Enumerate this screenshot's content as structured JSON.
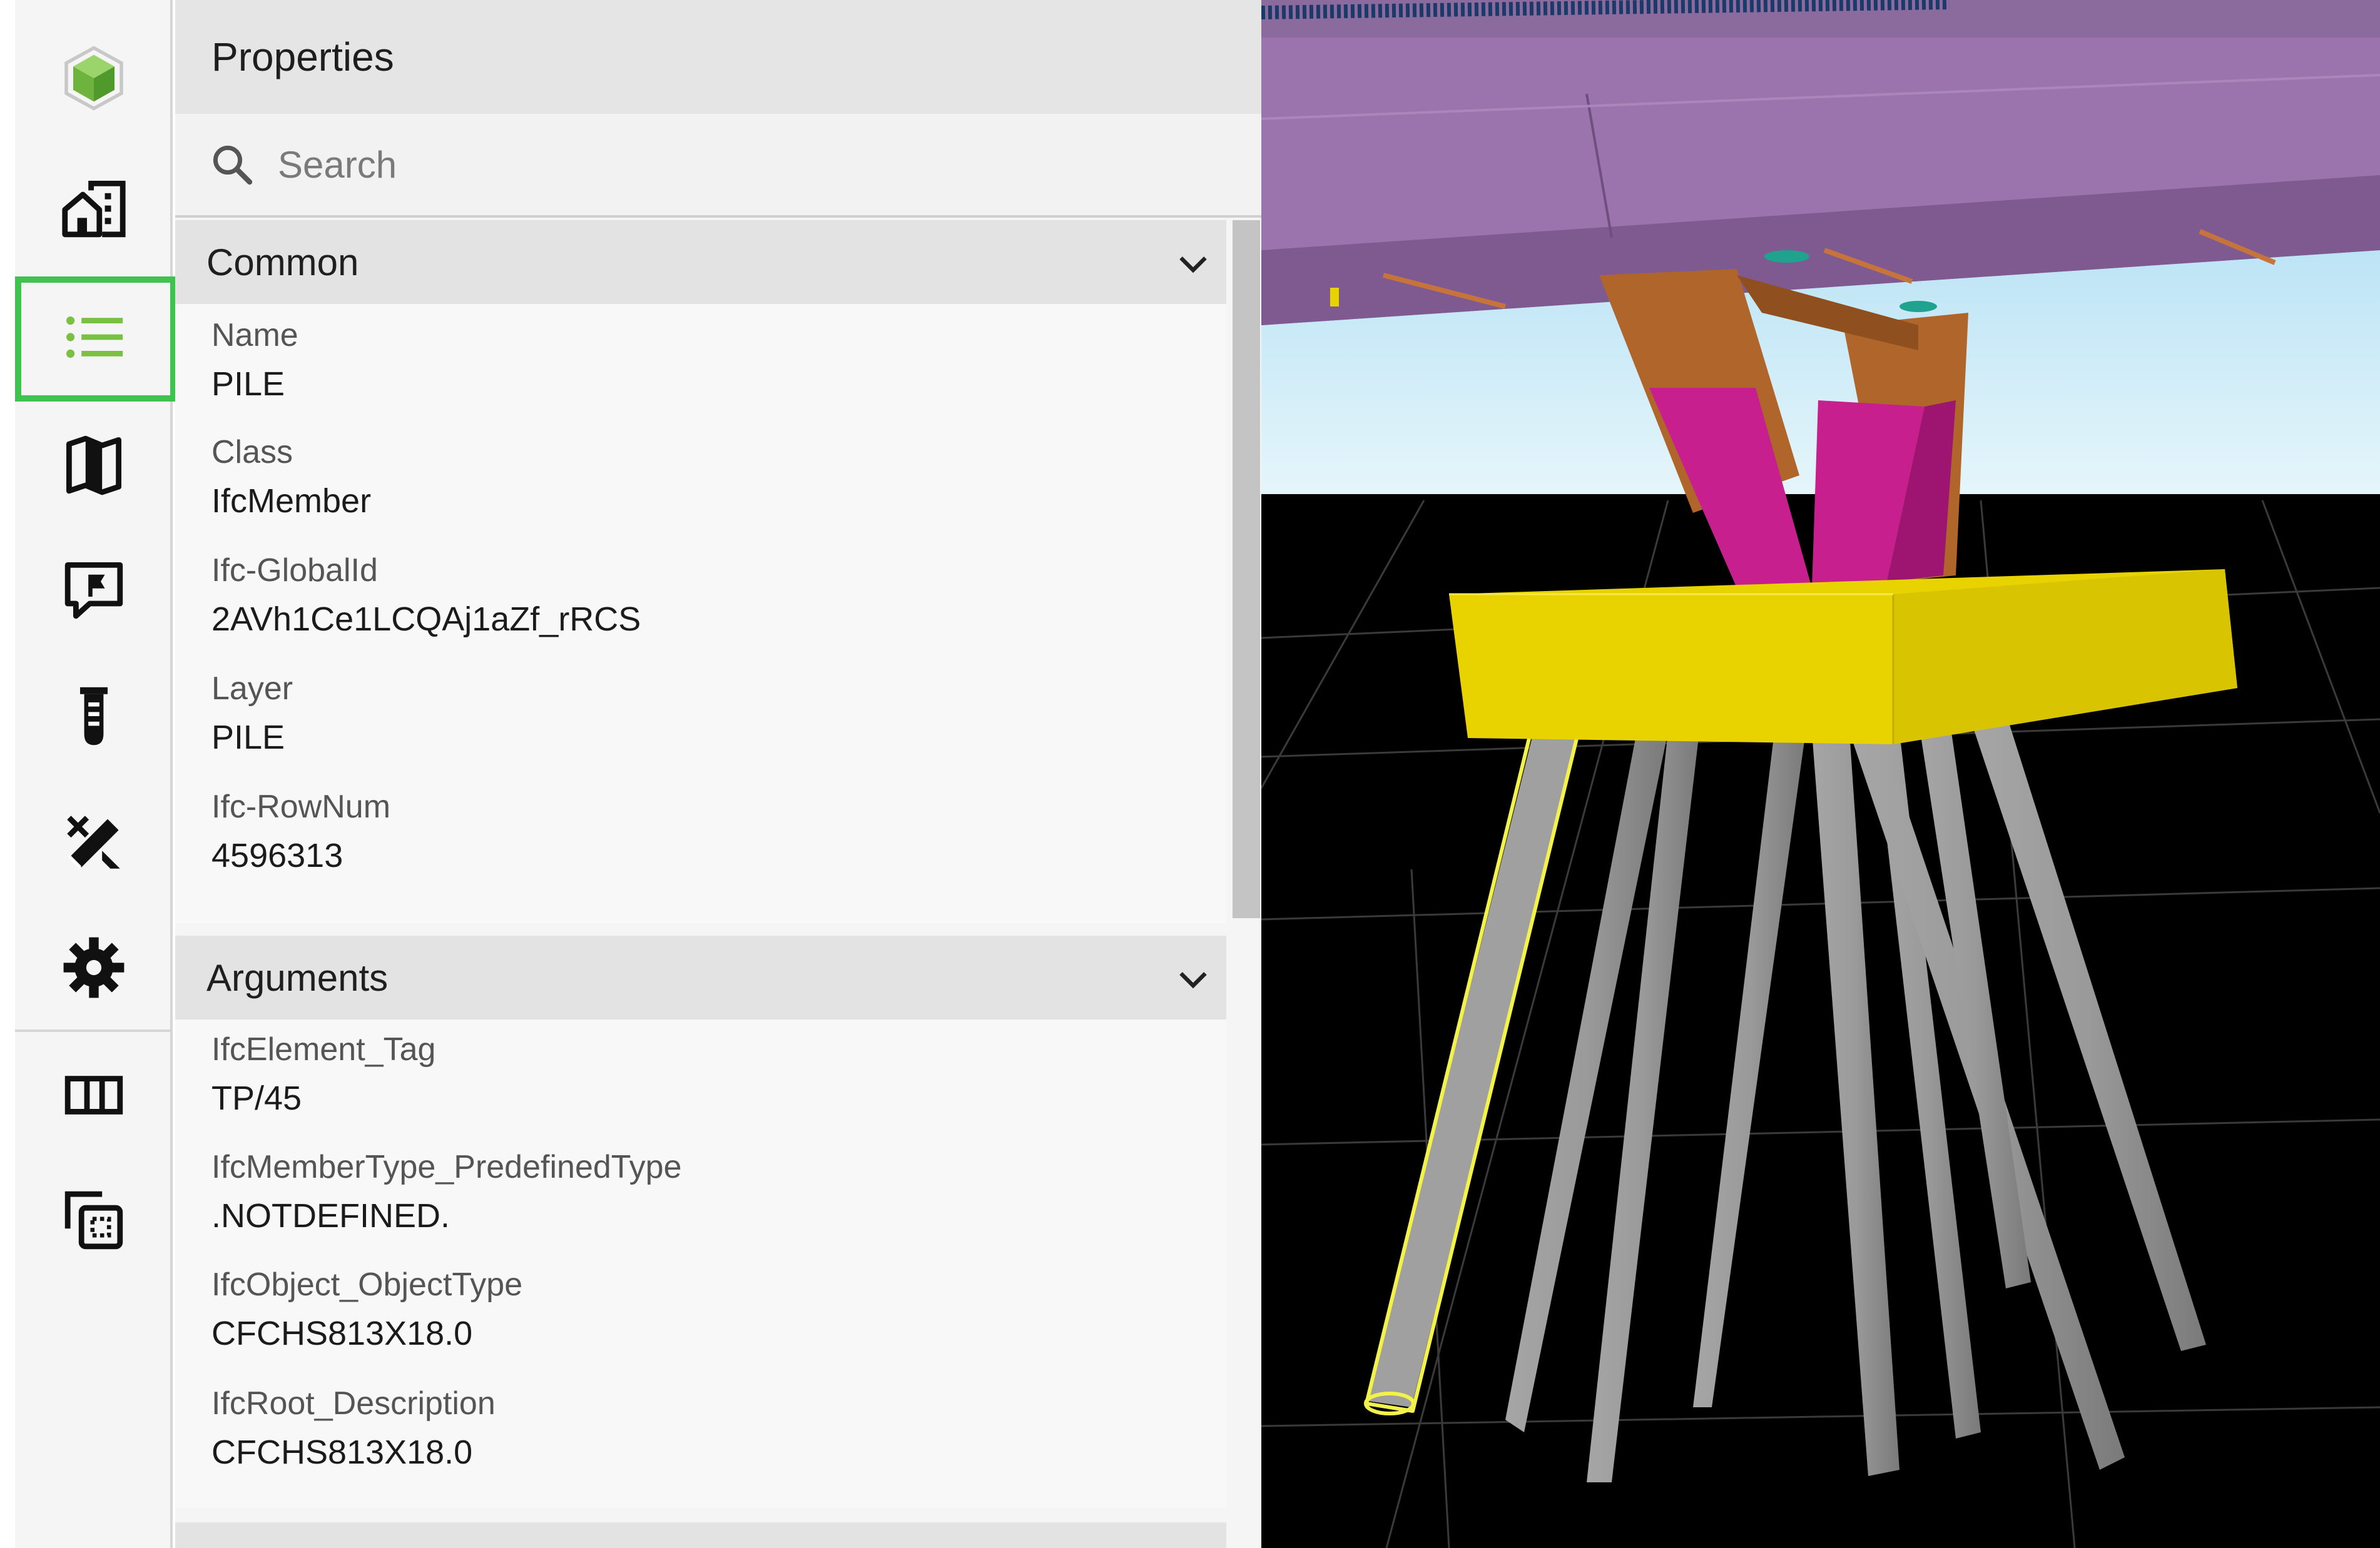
{
  "sidebar": {
    "items": [
      {
        "icon": "app-logo-icon"
      },
      {
        "icon": "buildings-icon"
      },
      {
        "icon": "list-icon",
        "selected": true
      },
      {
        "icon": "map-icon"
      },
      {
        "icon": "comment-flag-icon"
      },
      {
        "icon": "test-tube-icon"
      },
      {
        "icon": "measure-tools-icon"
      },
      {
        "icon": "gear-icon"
      },
      {
        "icon": "columns-icon"
      },
      {
        "icon": "select-region-icon"
      }
    ],
    "accent_color": "#3fc24f",
    "logo_color": "#7ac143"
  },
  "panel": {
    "title": "Properties",
    "search": {
      "placeholder": "Search",
      "value": ""
    },
    "sections": [
      {
        "title": "Common",
        "expanded": true,
        "properties": [
          {
            "label": "Name",
            "value": "PILE"
          },
          {
            "label": "Class",
            "value": "IfcMember"
          },
          {
            "label": "Ifc-GlobalId",
            "value": "2AVh1Ce1LCQAj1aZf_rRCS"
          },
          {
            "label": "Layer",
            "value": "PILE"
          },
          {
            "label": "Ifc-RowNum",
            "value": "4596313"
          }
        ]
      },
      {
        "title": "Arguments",
        "expanded": true,
        "properties": [
          {
            "label": "IfcElement_Tag",
            "value": "TP/45"
          },
          {
            "label": "IfcMemberType_PredefinedType",
            "value": ".NOTDEFINED."
          },
          {
            "label": "IfcObject_ObjectType",
            "value": "CFCHS813X18.0"
          },
          {
            "label": "IfcRoot_Description",
            "value": "CFCHS813X18.0"
          }
        ]
      }
    ]
  },
  "viewport": {
    "colors": {
      "deck": "#9b74ad",
      "pier_brown": "#b0652a",
      "pier_magenta": "#c81f8e",
      "pile_cap": "#e8d200",
      "piles": "#9a9a9a",
      "selection_outline": "#f2f24a",
      "sky": "#bfe6f6",
      "ground": "#000000"
    },
    "selected_object": "PILE"
  }
}
